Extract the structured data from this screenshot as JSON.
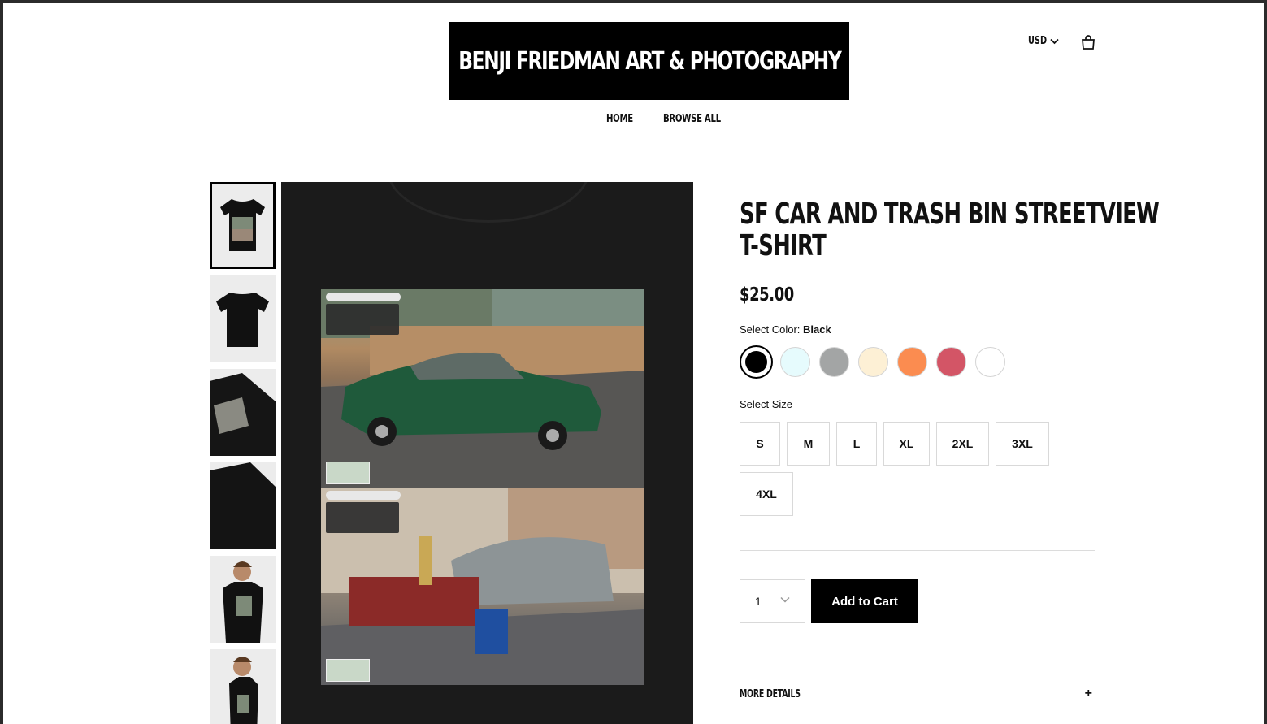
{
  "header": {
    "logo_text": "BENJI FRIEDMAN ART & PHOTOGRAPHY",
    "nav": [
      "HOME",
      "BROWSE ALL"
    ],
    "currency": "USD",
    "cart_icon": "shopping-bag-icon"
  },
  "product": {
    "title_line1": "SF CAR AND TRASH BIN STREETVIEW",
    "title_line2": "T-SHIRT",
    "price": "$25.00",
    "color_label": "Select Color:",
    "selected_color": "Black",
    "colors": [
      "#000000",
      "#e6fbfd",
      "#a3a5a5",
      "#fdf0d5",
      "#fb8c50",
      "#d35566",
      "#ffffff"
    ],
    "size_label": "Select Size",
    "sizes": [
      "S",
      "M",
      "L",
      "XL",
      "2XL",
      "3XL",
      "4XL"
    ],
    "quantity": "1",
    "add_to_cart": "Add to Cart",
    "more_details": "MORE DETAILS",
    "more_details_icon": "+"
  },
  "gallery": {
    "thumbnail_count": 6,
    "selected_index": 0
  }
}
